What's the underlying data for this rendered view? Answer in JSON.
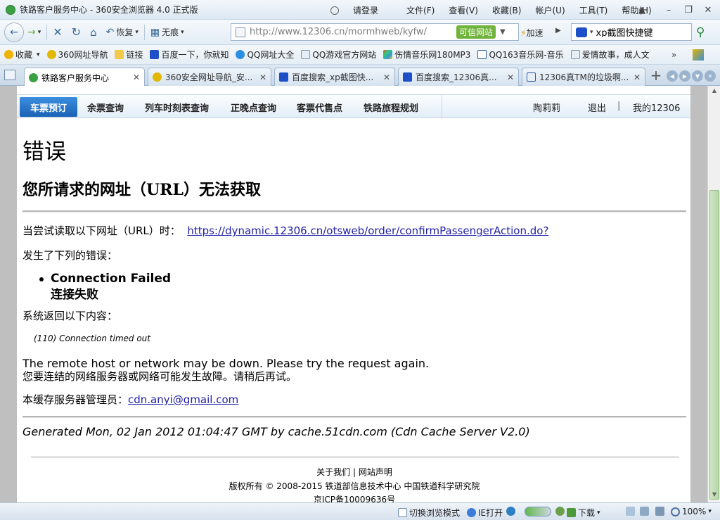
{
  "window": {
    "title": "铁路客户服务中心 - 360安全浏览器 4.0 正式版",
    "login": "请登录",
    "menus": [
      "文件(F)",
      "查看(V)",
      "收藏(B)",
      "帐户(U)",
      "工具(T)",
      "帮助(H)"
    ]
  },
  "toolbar": {
    "restore": "恢复",
    "incognito": "无痕",
    "url": "http://www.12306.cn/mormhweb/kyfw/",
    "trusted": "可信网站",
    "accelerate": "加速",
    "search_value": "xp截图快捷键"
  },
  "favorites": {
    "collect": "收藏",
    "items": [
      "360网址导航",
      "链接",
      "百度一下，你就知",
      "QQ网址大全",
      "QQ游戏官方网站",
      "伤情音乐网180MP3",
      "QQ163音乐网-音乐",
      "爱情故事，成人文"
    ],
    "more": "»"
  },
  "tabs": [
    {
      "label": "铁路客户服务中心",
      "active": true
    },
    {
      "label": "360安全网址导航_安...",
      "active": false
    },
    {
      "label": "百度搜索_xp截图快...",
      "active": false
    },
    {
      "label": "百度搜索_12306真...",
      "active": false
    },
    {
      "label": "12306真TM的垃圾啊...",
      "active": false
    }
  ],
  "site_nav": {
    "booking": "车票预订",
    "items": [
      "余票查询",
      "列车时刻表查询",
      "正晚点查询",
      "客票代售点",
      "铁路旅程规划"
    ],
    "user": "陶莉莉",
    "logout": "退出",
    "sep": "|",
    "my12306": "我的12306"
  },
  "error": {
    "heading": "错误",
    "subheading": "您所请求的网址（URL）无法获取",
    "try_label": "当尝试读取以下网址（URL）时：",
    "try_url": "https://dynamic.12306.cn/otsweb/order/confirmPassengerAction.do?",
    "errors_label": "发生了下列的错误：",
    "error_en": "Connection Failed",
    "error_cn": "连接失败",
    "system_label": "系统返回以下内容：",
    "system_msg": "(110) Connection timed out",
    "remote_en": "The remote host or network may be down. Please try the request again.",
    "remote_cn": "您要连结的网络服务器或网络可能发生故障。请稍后再试。",
    "admin_label": "本缓存服务器管理员：",
    "admin_email": "cdn.anyi@gmail.com",
    "generated": "Generated Mon, 02 Jan 2012 01:04:47 GMT by cache.51cdn.com (Cdn Cache Server V2.0)"
  },
  "footer": {
    "about": "关于我们",
    "sep": "|",
    "statement": "网站声明",
    "copyright": "版权所有 © 2008-2015 铁道部信息技术中心 中国铁道科学研究院",
    "icp": "京ICP备10009636号"
  },
  "statusbar": {
    "switch_mode": "切换浏览模式",
    "ie_open": "IE打开",
    "download": "下载",
    "zoom": "100%"
  }
}
